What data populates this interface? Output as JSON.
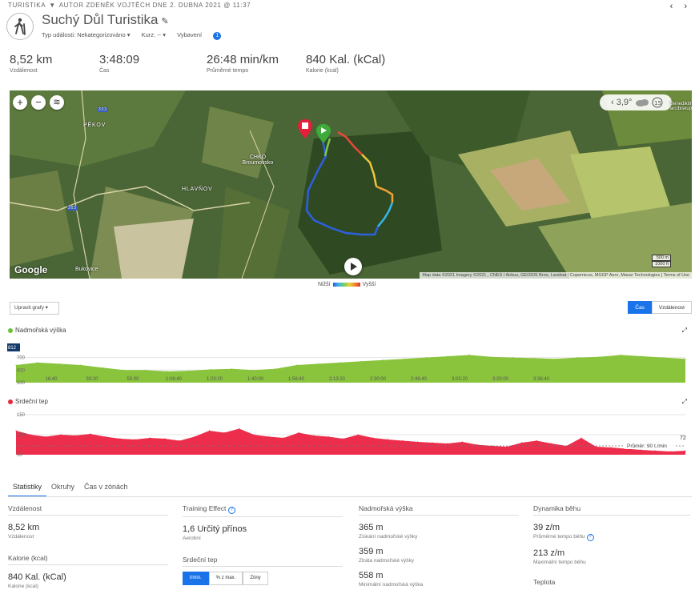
{
  "breadcrumb": {
    "section": "TURISTIKA",
    "author_line": "AUTOR ZDENĚK VOJTĚCH DNE 2. DUBNA 2021 @ 11:37"
  },
  "nav": {
    "prev": "‹",
    "next": "›"
  },
  "activity": {
    "title": "Suchý Důl Turistika",
    "meta": {
      "event_type": "Typ události: Nekategorizováno ▾",
      "course": "Kurz: -- ▾",
      "equipment": "Vybavení",
      "equipment_count": "1"
    }
  },
  "summary": [
    {
      "value": "8,52 km",
      "label": "Vzdálenost"
    },
    {
      "value": "3:48:09",
      "label": "Čas"
    },
    {
      "value": "26:48 min/km",
      "label": "Průměrné tempo"
    },
    {
      "value": "840 Kal. (kCal)",
      "label": "Kalorie (kcal)"
    }
  ],
  "map": {
    "zoom_in": "+",
    "zoom_out": "−",
    "layers": "≋",
    "weather": {
      "temperature": "3,9°",
      "icon": "cloud-icon"
    },
    "places": {
      "pekov": "PĚKOV",
      "hlavnov": "HLAVŇOV",
      "chko": "CHKO Broumovsko",
      "bukovice": "Bukovice",
      "benedikt": "Benediktin arcibiskup"
    },
    "road_numbers": [
      "303",
      "303"
    ],
    "google": "Google",
    "attribution": "Map data ©2021 Imagery ©2021 , CNES / Airbus, GEODIS Brno, Landsat / Copernicus, MGGP Aero, Maxar Technologies | Terms of Use",
    "scale_500": "500 m",
    "scale_1000": "1000 ft"
  },
  "legend": {
    "low": "Nižší",
    "high": "Vyšší"
  },
  "controls": {
    "charts_button": "Upravit grafy ▾",
    "toggle_time": "Čas",
    "toggle_distance": "Vzdálenost"
  },
  "elevation_chart": {
    "title": "Nadmořská výška",
    "y_ticks": [
      "812",
      "700",
      "600",
      "500"
    ],
    "x_ticks": [
      "16:40",
      "33:20",
      "50:00",
      "1:06:40",
      "1:23:20",
      "1:40:00",
      "1:56:40",
      "2:13:20",
      "2:30:00",
      "2:46:40",
      "3:03:20",
      "3:20:00",
      "3:36:40"
    ]
  },
  "hr_chart": {
    "title": "Srdeční tep",
    "y_ticks": [
      "150",
      "100",
      "50"
    ],
    "avg_label": "Průměr: 90 t./min",
    "avg_value": "72"
  },
  "chart_data": [
    {
      "type": "area",
      "title": "Nadmořská výška",
      "ylim": [
        500,
        812
      ],
      "x_ticks": [
        "16:40",
        "33:20",
        "50:00",
        "1:06:40",
        "1:23:20",
        "1:40:00",
        "1:56:40",
        "2:13:20",
        "2:30:00",
        "2:46:40",
        "3:03:20",
        "3:20:00",
        "3:36:40"
      ],
      "values": [
        640,
        660,
        650,
        640,
        620,
        600,
        600,
        590,
        595,
        605,
        610,
        600,
        610,
        640,
        650,
        660,
        670,
        680,
        690,
        700,
        710,
        720,
        705,
        700,
        695,
        690,
        700,
        705,
        720,
        710,
        700,
        690
      ]
    },
    {
      "type": "area",
      "title": "Srdeční tep",
      "ylim": [
        50,
        150
      ],
      "values": [
        110,
        100,
        95,
        100,
        98,
        102,
        95,
        90,
        88,
        92,
        90,
        85,
        95,
        110,
        105,
        115,
        100,
        95,
        92,
        105,
        98,
        95,
        90,
        100,
        92,
        88,
        85,
        82,
        80,
        78,
        82,
        75,
        72,
        70,
        80,
        85,
        78,
        72,
        92,
        70,
        68,
        65,
        62,
        60,
        58,
        60
      ]
    }
  ],
  "tabs": [
    "Statistiky",
    "Okruhy",
    "Čas v zónách"
  ],
  "stats_cols": {
    "distance": {
      "header": "Vzdálenost",
      "rows": [
        {
          "value": "8,52 km",
          "label": "Vzdálenost"
        }
      ]
    },
    "calories": {
      "header": "Kalorie (kcal)",
      "value": "840 Kal. (kCal)",
      "label": "Kalorie (kcal)"
    },
    "training": {
      "header": "Training Effect",
      "value": "1,6 Určitý přínos",
      "label": "Aerobní"
    },
    "hr": {
      "header": "Srdeční tep",
      "toggle": [
        "t/min.",
        "% z max.",
        "Zóny"
      ]
    },
    "elevation": {
      "header": "Nadmořská výška",
      "rows": [
        {
          "value": "365 m",
          "label": "Získání nadmořské výšky"
        },
        {
          "value": "359 m",
          "label": "Ztráta nadmořské výšky"
        },
        {
          "value": "558 m",
          "label": "Minimální nadmořská výška"
        }
      ]
    },
    "dynamics": {
      "header": "Dynamika běhu",
      "rows": [
        {
          "value": "39 z/m",
          "label": "Průměrné tempo běhu"
        },
        {
          "value": "213 z/m",
          "label": "Maximální tempo běhu"
        }
      ],
      "temp_header": "Teplota"
    }
  }
}
